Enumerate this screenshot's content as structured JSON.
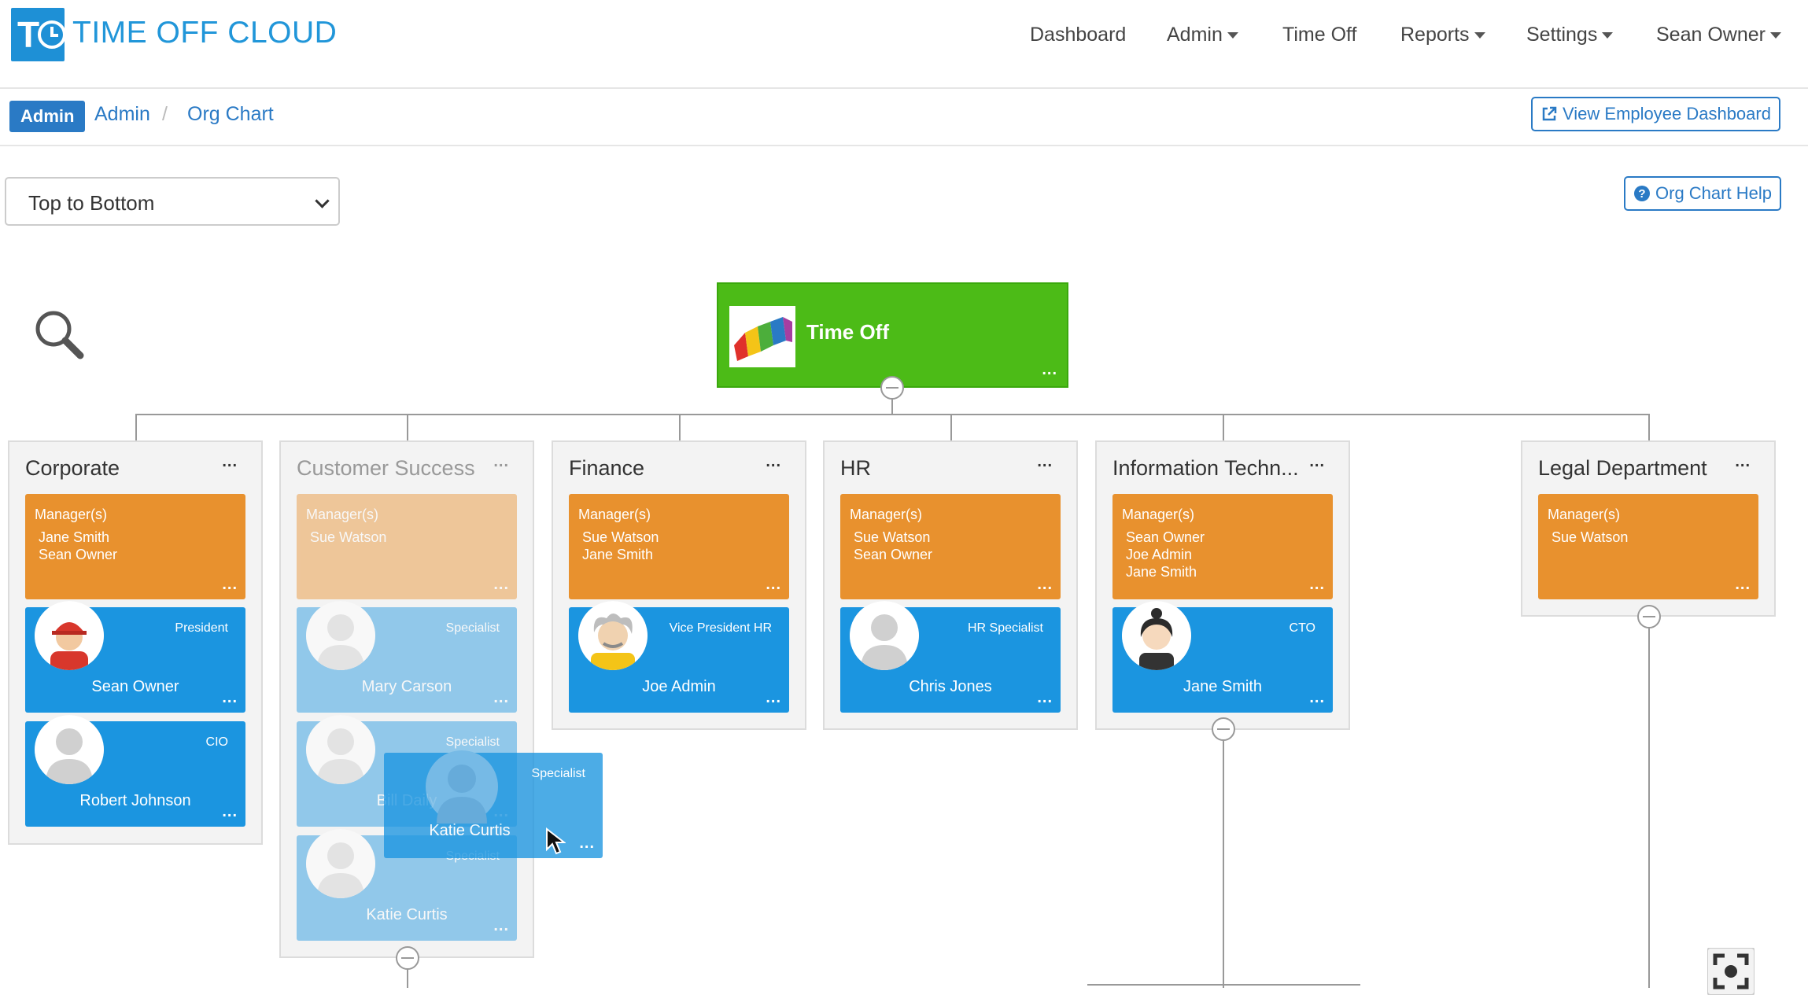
{
  "brand": {
    "name": "TIME OFF CLOUD",
    "logo_text": "T",
    "color": "#1e90d6"
  },
  "nav": {
    "items": [
      {
        "label": "Dashboard",
        "dropdown": false
      },
      {
        "label": "Admin",
        "dropdown": true
      },
      {
        "label": "Time Off",
        "dropdown": false
      },
      {
        "label": "Reports",
        "dropdown": true
      },
      {
        "label": "Settings",
        "dropdown": true
      },
      {
        "label": "Sean Owner",
        "dropdown": true
      }
    ]
  },
  "breadcrumb": {
    "badge": "Admin",
    "items": [
      "Admin",
      "Org Chart"
    ],
    "separator": "/"
  },
  "buttons": {
    "view_employee_dashboard": "View Employee Dashboard",
    "org_chart_help": "Org Chart Help"
  },
  "layout_select": {
    "selected": "Top to Bottom"
  },
  "chart": {
    "root": {
      "title": "Time Off",
      "menu": "..."
    },
    "menu": "...",
    "manager_label": "Manager(s)",
    "departments": [
      {
        "name": "Corporate",
        "managers": [
          "Jane Smith",
          "Sean Owner"
        ],
        "employees": [
          {
            "name": "Sean Owner",
            "title": "President"
          },
          {
            "name": "Robert Johnson",
            "title": "CIO"
          }
        ]
      },
      {
        "name": "Customer Success",
        "managers": [
          "Sue Watson"
        ],
        "employees": [
          {
            "name": "Mary Carson",
            "title": "Specialist"
          },
          {
            "name": "Bill Daily",
            "title": "Specialist"
          },
          {
            "name": "Katie Curtis",
            "title": "Specialist"
          }
        ]
      },
      {
        "name": "Finance",
        "managers": [
          "Sue Watson",
          "Jane Smith"
        ],
        "employees": [
          {
            "name": "Joe Admin",
            "title": "Vice President HR"
          }
        ]
      },
      {
        "name": "HR",
        "managers": [
          "Sue Watson",
          "Sean Owner"
        ],
        "employees": [
          {
            "name": "Chris Jones",
            "title": "HR Specialist"
          }
        ]
      },
      {
        "name": "Information Techn...",
        "managers": [
          "Sean Owner",
          "Joe Admin",
          "Jane Smith"
        ],
        "employees": [
          {
            "name": "Jane Smith",
            "title": "CTO"
          }
        ]
      },
      {
        "name": "Legal Department",
        "managers": [
          "Sue Watson"
        ],
        "employees": []
      }
    ],
    "dragging": {
      "name": "Katie Curtis",
      "title": "Specialist"
    }
  },
  "colors": {
    "root_green": "#4cbb17",
    "manager_orange": "#e8912e",
    "employee_blue": "#1b95e0",
    "link_blue": "#2a7ac5"
  },
  "icons": [
    "search-icon",
    "chevron-down-icon",
    "external-link-icon",
    "help-circle-icon",
    "fullscreen-icon"
  ]
}
